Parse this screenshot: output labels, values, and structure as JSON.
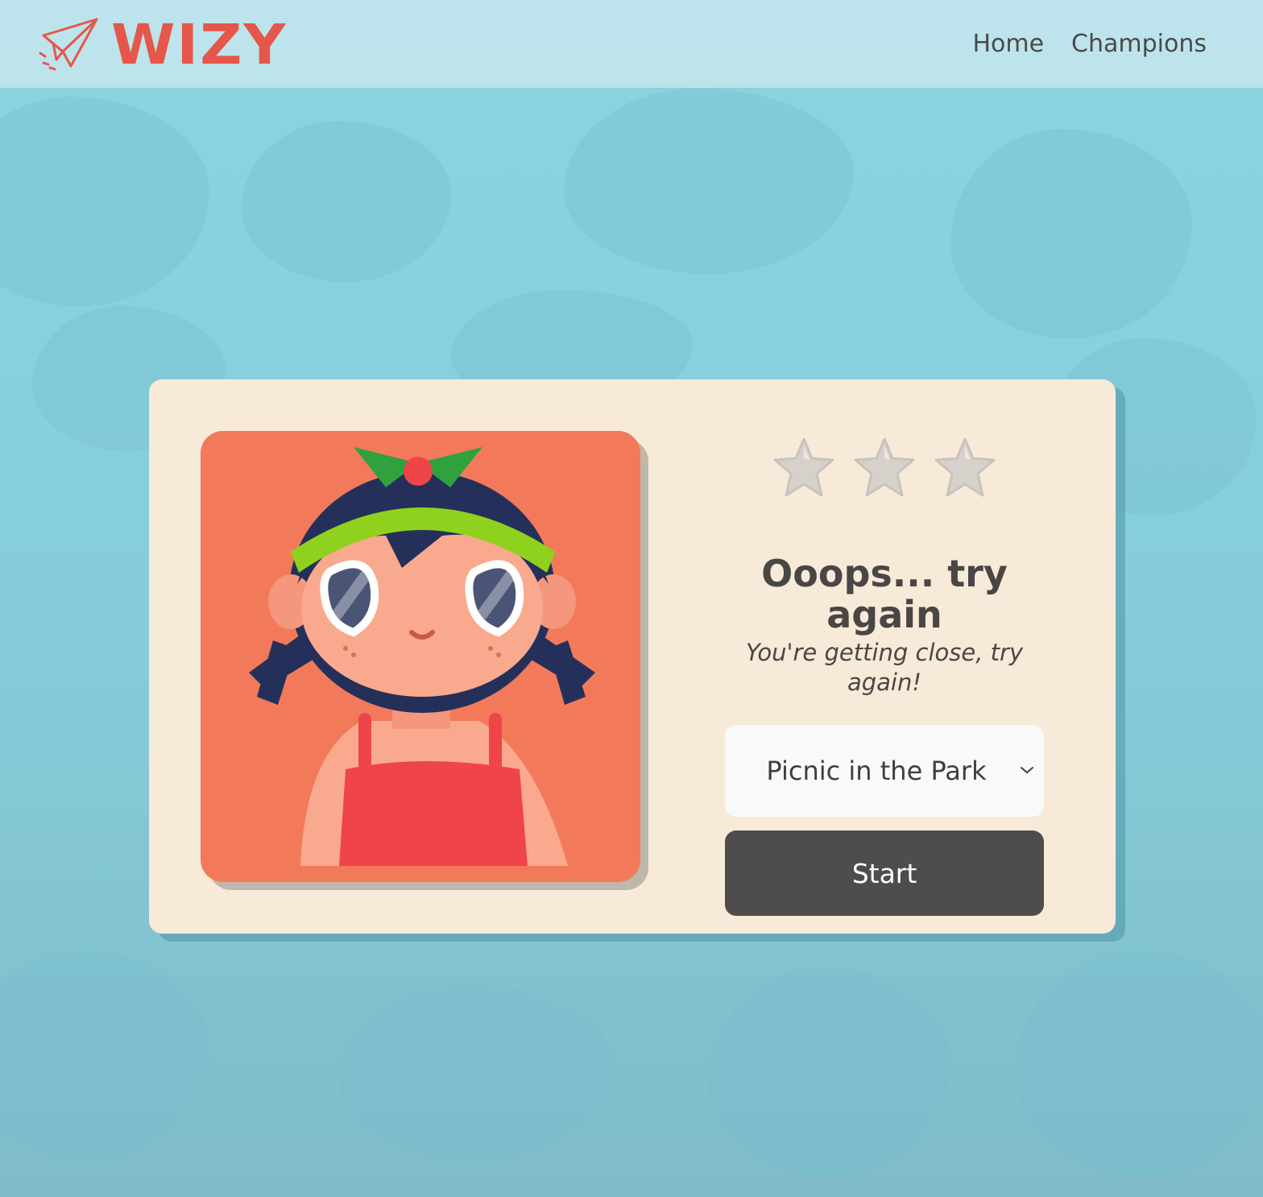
{
  "header": {
    "brand": "WIZY",
    "nav": [
      {
        "label": "Home"
      },
      {
        "label": "Champions"
      }
    ]
  },
  "result": {
    "stars_earned": 0,
    "stars_total": 3,
    "title": "Ooops... try again",
    "subtitle": "You're getting close, try again!",
    "scenario_select": {
      "selected": "Picnic in the Park"
    },
    "start_label": "Start"
  },
  "colors": {
    "brand": "#e5574a",
    "card": "#f7ead8",
    "avatar_bg": "#f27a5a",
    "button": "#4f4d4b",
    "background": "#86cdd9"
  },
  "icons": [
    "paper-plane-icon",
    "star-icon",
    "chevron-down-icon"
  ]
}
